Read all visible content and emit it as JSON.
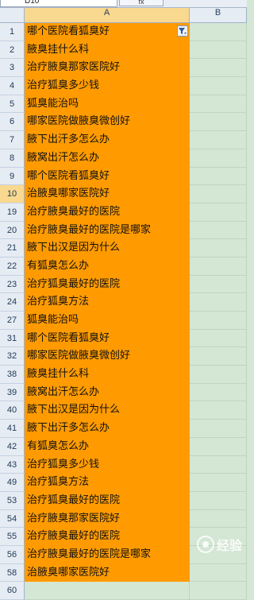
{
  "toolbar": {
    "name_box": "D10",
    "fx_label": "fx"
  },
  "columns": {
    "a": "A",
    "b": "B"
  },
  "rows": [
    {
      "num": "1",
      "text": "哪个医院看狐臭好"
    },
    {
      "num": "2",
      "text": "腋臭挂什么科"
    },
    {
      "num": "3",
      "text": "治疗腋臭那家医院好"
    },
    {
      "num": "4",
      "text": "治疗狐臭多少钱"
    },
    {
      "num": "5",
      "text": "狐臭能治吗"
    },
    {
      "num": "6",
      "text": "哪家医院做腋臭微创好"
    },
    {
      "num": "7",
      "text": "腋下出汗多怎么办"
    },
    {
      "num": "8",
      "text": "腋窝出汗怎么办"
    },
    {
      "num": "9",
      "text": "哪个医院看狐臭好"
    },
    {
      "num": "10",
      "text": "治腋臭哪家医院好"
    },
    {
      "num": "19",
      "text": "治疗腋臭最好的医院"
    },
    {
      "num": "20",
      "text": "治疗腋臭最好的医院是哪家"
    },
    {
      "num": "21",
      "text": "腋下出汉是因为什么"
    },
    {
      "num": "22",
      "text": "有狐臭怎么办"
    },
    {
      "num": "23",
      "text": "治疗狐臭最好的医院"
    },
    {
      "num": "24",
      "text": "治疗狐臭方法"
    },
    {
      "num": "27",
      "text": "狐臭能治吗"
    },
    {
      "num": "31",
      "text": "哪个医院看狐臭好"
    },
    {
      "num": "32",
      "text": "哪家医院做腋臭微创好"
    },
    {
      "num": "38",
      "text": "腋臭挂什么科"
    },
    {
      "num": "39",
      "text": "腋窝出汗怎么办"
    },
    {
      "num": "40",
      "text": "腋下出汉是因为什么"
    },
    {
      "num": "41",
      "text": "腋下出汗多怎么办"
    },
    {
      "num": "42",
      "text": "有狐臭怎么办"
    },
    {
      "num": "43",
      "text": "治疗狐臭多少钱"
    },
    {
      "num": "49",
      "text": "治疗狐臭方法"
    },
    {
      "num": "53",
      "text": "治疗狐臭最好的医院"
    },
    {
      "num": "54",
      "text": "治疗腋臭那家医院好"
    },
    {
      "num": "55",
      "text": "治疗腋臭最好的医院"
    },
    {
      "num": "56",
      "text": "治疗腋臭最好的医院是哪家"
    },
    {
      "num": "58",
      "text": "治腋臭哪家医院好"
    },
    {
      "num": "60",
      "text": ""
    }
  ],
  "watermark": {
    "text": "经验"
  },
  "colors": {
    "highlight": "#ff9b00",
    "sheet_bg": "#d4e6d4",
    "header_bg": "#e6ecf3"
  }
}
